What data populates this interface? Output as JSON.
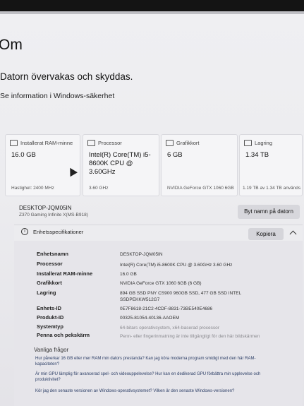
{
  "page": {
    "title": "Om",
    "protect_text": "Datorn övervakas och skyddas.",
    "security_link": "Se information i Windows-säkerhet"
  },
  "cards": [
    {
      "icon": "ram-icon",
      "label": "Installerat RAM-minne",
      "value": "16.0 GB",
      "foot": "Hastighet: 2400 MHz"
    },
    {
      "icon": "processor-icon",
      "label": "Processor",
      "value": "Intel(R) Core(TM) i5-8600K CPU @ 3.60GHz",
      "foot": "3.60 GHz"
    },
    {
      "icon": "graphics-card-icon",
      "label": "Grafikkort",
      "value": "6 GB",
      "foot": "NVIDIA GeForce GTX 1060 6GB"
    },
    {
      "icon": "storage-icon",
      "label": "Lagring",
      "value": "1.34 TB",
      "foot": "1.19 TB av 1.34 TB används"
    }
  ],
  "device": {
    "name": "DESKTOP-JQM05IN",
    "model": "Z370 Gaming Infinite X(MS-B918)",
    "rename_label": "Byt namn på datorn"
  },
  "specs": {
    "title": "Enhetsspecifikationer",
    "copy_label": "Kopiera",
    "rows": [
      {
        "label": "Enhetsnamn",
        "value": "DESKTOP-JQM05IN"
      },
      {
        "label": "Processor",
        "value": "Intel(R) Core(TM) i5-8600K CPU @ 3.60GHz   3.60 GHz"
      },
      {
        "label": "Installerat RAM-minne",
        "value": "16.0 GB"
      },
      {
        "label": "Grafikkort",
        "value": "NVIDIA GeForce GTX 1060 6GB (6 GB)"
      },
      {
        "label": "Lagring",
        "value": "894 GB SSD PNY CS900 960GB SSD, 477 GB SSD INTEL SSDPEKKW512G7"
      },
      {
        "label": "Enhets-ID",
        "value": "0E7F8618-21C2-4CDF-8831-73BE540E4686"
      },
      {
        "label": "Produkt-ID",
        "value": "00325-81054-40136-AAOEM"
      },
      {
        "label": "Systemtyp",
        "value": "64-bitars operativsystem, x64-baserad processor"
      },
      {
        "label": "Penna och pekskärm",
        "value": "Penn- eller fingerinmatning är inte tillgängligt för den här bildskärmen"
      }
    ]
  },
  "faq": {
    "title": "Vanliga frågor",
    "questions": [
      "Hur påverkar 16 GB eller mer RAM min dators prestanda? Kan jag köra moderna program smidigt med den här RAM-kapaciteten?",
      "Är min GPU lämplig för avancerad spel- och videouppelevelse? Hur kan en dedikerad GPU förbättra min upplevelse och produktivitet?",
      "Kör jag den senaste versionen av Windows-operativsystemet? Vilken är den senaste Windows-versionen?"
    ]
  }
}
